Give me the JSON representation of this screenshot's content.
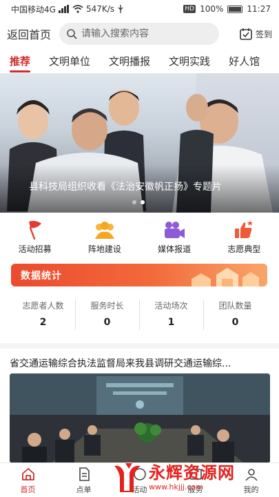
{
  "status_bar": {
    "carrier": "中国移动4G",
    "speed": "547K/s",
    "hd": "HD",
    "battery": "100%",
    "time": "11:27"
  },
  "header": {
    "back_label": "返回首页",
    "search_placeholder": "请输入搜索内容",
    "checkin_label": "签到"
  },
  "tabs": [
    {
      "label": "推荐",
      "active": true
    },
    {
      "label": "文明单位"
    },
    {
      "label": "文明播报"
    },
    {
      "label": "文明实践"
    },
    {
      "label": "好人馆"
    }
  ],
  "banner": {
    "caption": "县科技局组织收看《法治安徽帆正扬》专题片",
    "slide_count": 2,
    "active_slide": 2
  },
  "quick_menu": [
    {
      "label": "活动招募",
      "icon": "flag-icon",
      "color": "#e03c31"
    },
    {
      "label": "阵地建设",
      "icon": "group-icon",
      "color": "#f5a623"
    },
    {
      "label": "媒体报道",
      "icon": "video-camera-icon",
      "color": "#8e5bd6"
    },
    {
      "label": "志愿典型",
      "icon": "thumbs-up-icon",
      "color": "#ef5a3a"
    }
  ],
  "stats": {
    "title": "数据统计",
    "items": [
      {
        "label": "志愿者人数",
        "value": "2"
      },
      {
        "label": "服务时长",
        "value": "0"
      },
      {
        "label": "活动场次",
        "value": "1"
      },
      {
        "label": "团队数量",
        "value": "0"
      }
    ]
  },
  "news": {
    "title": "省交通运输综合执法监督局来我县调研交通运输综..."
  },
  "bottom_nav": [
    {
      "label": "首页",
      "icon": "home-icon",
      "active": true
    },
    {
      "label": "点单",
      "icon": "order-icon"
    },
    {
      "label": "活动",
      "icon": "activity-icon"
    },
    {
      "label": "服务",
      "icon": "service-icon"
    },
    {
      "label": "我的",
      "icon": "user-icon"
    }
  ],
  "watermark": {
    "main": "永辉资源网",
    "sub": "www.hkjjj.com"
  },
  "colors": {
    "accent": "#d22b2b",
    "stats_gradient_start": "#ec4a2e",
    "stats_gradient_end": "#f9a56a"
  }
}
